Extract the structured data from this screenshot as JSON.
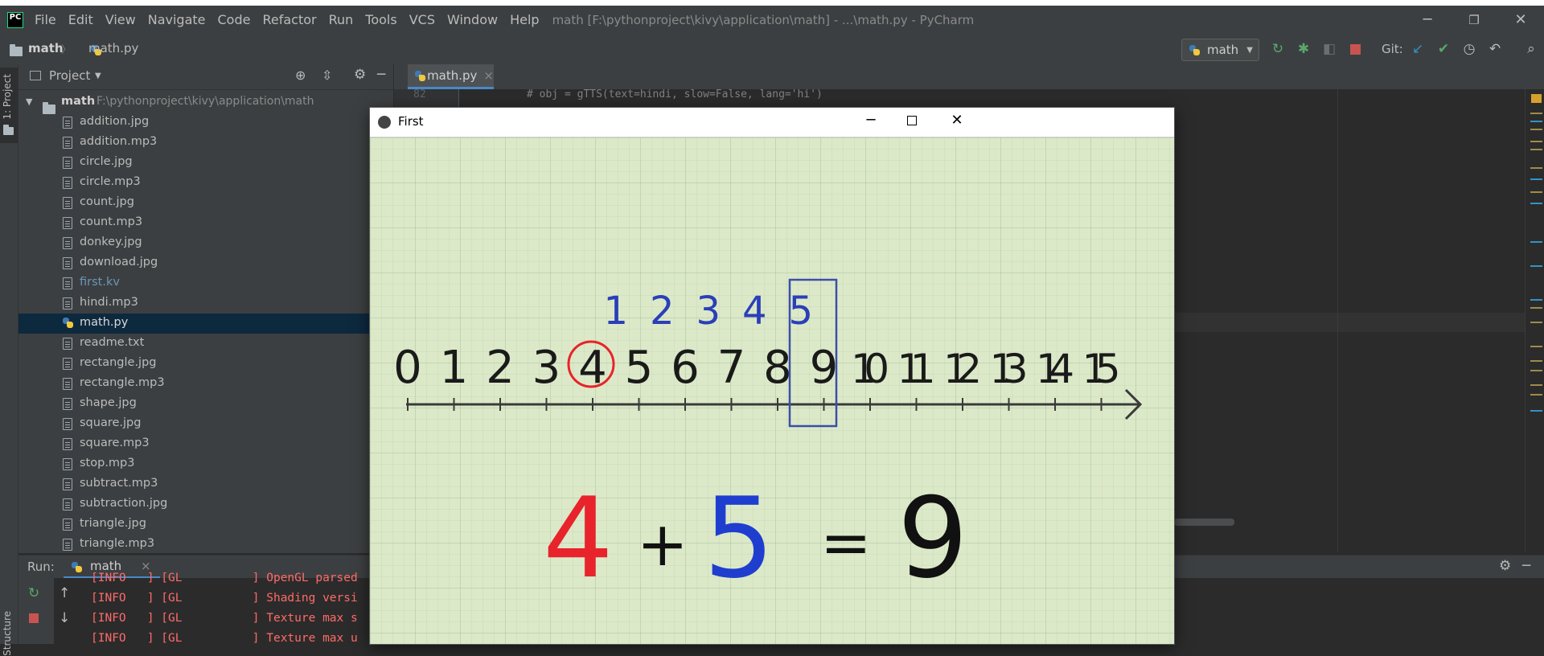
{
  "menubar": {
    "logo_text": "PC",
    "items": [
      "File",
      "Edit",
      "View",
      "Navigate",
      "Code",
      "Refactor",
      "Run",
      "Tools",
      "VCS",
      "Window",
      "Help"
    ],
    "window_title": "math [F:\\pythonproject\\kivy\\application\\math] - ...\\math.py - PyCharm",
    "minimize": "─",
    "restore": "❐",
    "close": "✕"
  },
  "navbar": {
    "crumb_root": "math",
    "separator": "〉",
    "crumb_file": "math.py",
    "run_config": "math",
    "git_label": "Git:"
  },
  "stripe": {
    "project_label": "1: Project",
    "structure_label": "Structure"
  },
  "project": {
    "title": "Project",
    "root_name": "math",
    "root_path": "F:\\pythonproject\\kivy\\application\\math",
    "files": [
      {
        "name": "addition.jpg",
        "kind": "file"
      },
      {
        "name": "addition.mp3",
        "kind": "audio"
      },
      {
        "name": "circle.jpg",
        "kind": "file"
      },
      {
        "name": "circle.mp3",
        "kind": "audio"
      },
      {
        "name": "count.jpg",
        "kind": "file"
      },
      {
        "name": "count.mp3",
        "kind": "audio"
      },
      {
        "name": "donkey.jpg",
        "kind": "file"
      },
      {
        "name": "download.jpg",
        "kind": "file"
      },
      {
        "name": "first.kv",
        "kind": "kv"
      },
      {
        "name": "hindi.mp3",
        "kind": "audio"
      },
      {
        "name": "math.py",
        "kind": "py",
        "selected": true
      },
      {
        "name": "readme.txt",
        "kind": "file"
      },
      {
        "name": "rectangle.jpg",
        "kind": "file"
      },
      {
        "name": "rectangle.mp3",
        "kind": "audio"
      },
      {
        "name": "shape.jpg",
        "kind": "file"
      },
      {
        "name": "square.jpg",
        "kind": "file"
      },
      {
        "name": "square.mp3",
        "kind": "audio"
      },
      {
        "name": "stop.mp3",
        "kind": "audio"
      },
      {
        "name": "subtract.mp3",
        "kind": "audio"
      },
      {
        "name": "subtraction.jpg",
        "kind": "file"
      },
      {
        "name": "triangle.jpg",
        "kind": "file"
      },
      {
        "name": "triangle.mp3",
        "kind": "audio"
      }
    ]
  },
  "editor": {
    "tab_label": "math.py",
    "tab_close": "×",
    "line_number": "82",
    "code_line": "# obj = gTTS(text=hindi, slow=False, lang='hi')"
  },
  "run": {
    "label": "Run:",
    "tab_label": "math",
    "tab_close": "×",
    "log": [
      "[INFO   ] [GL          ] OpenGL parsed",
      "[INFO   ] [GL          ] Shading versi",
      "[INFO   ] [GL          ] Texture max s",
      "[INFO   ] [GL          ] Texture max u"
    ]
  },
  "kivy_window": {
    "title": "First",
    "numbers": [
      "0",
      "1",
      "2",
      "3",
      "4",
      "5",
      "6",
      "7",
      "8",
      "9",
      "10",
      "11",
      "12",
      "13",
      "14",
      "15"
    ],
    "jumps": [
      "1",
      "2",
      "3",
      "4",
      "5"
    ],
    "equation": {
      "a": "4",
      "op": "+",
      "b": "5",
      "eq": "=",
      "result": "9"
    }
  },
  "colors": {
    "ide_bg": "#2b2b2b",
    "panel_bg": "#3c3f41",
    "selection": "#0d293e",
    "accent": "#4a88c7",
    "red_mark": "#e8232b",
    "blue_mark": "#1f3ecf"
  }
}
